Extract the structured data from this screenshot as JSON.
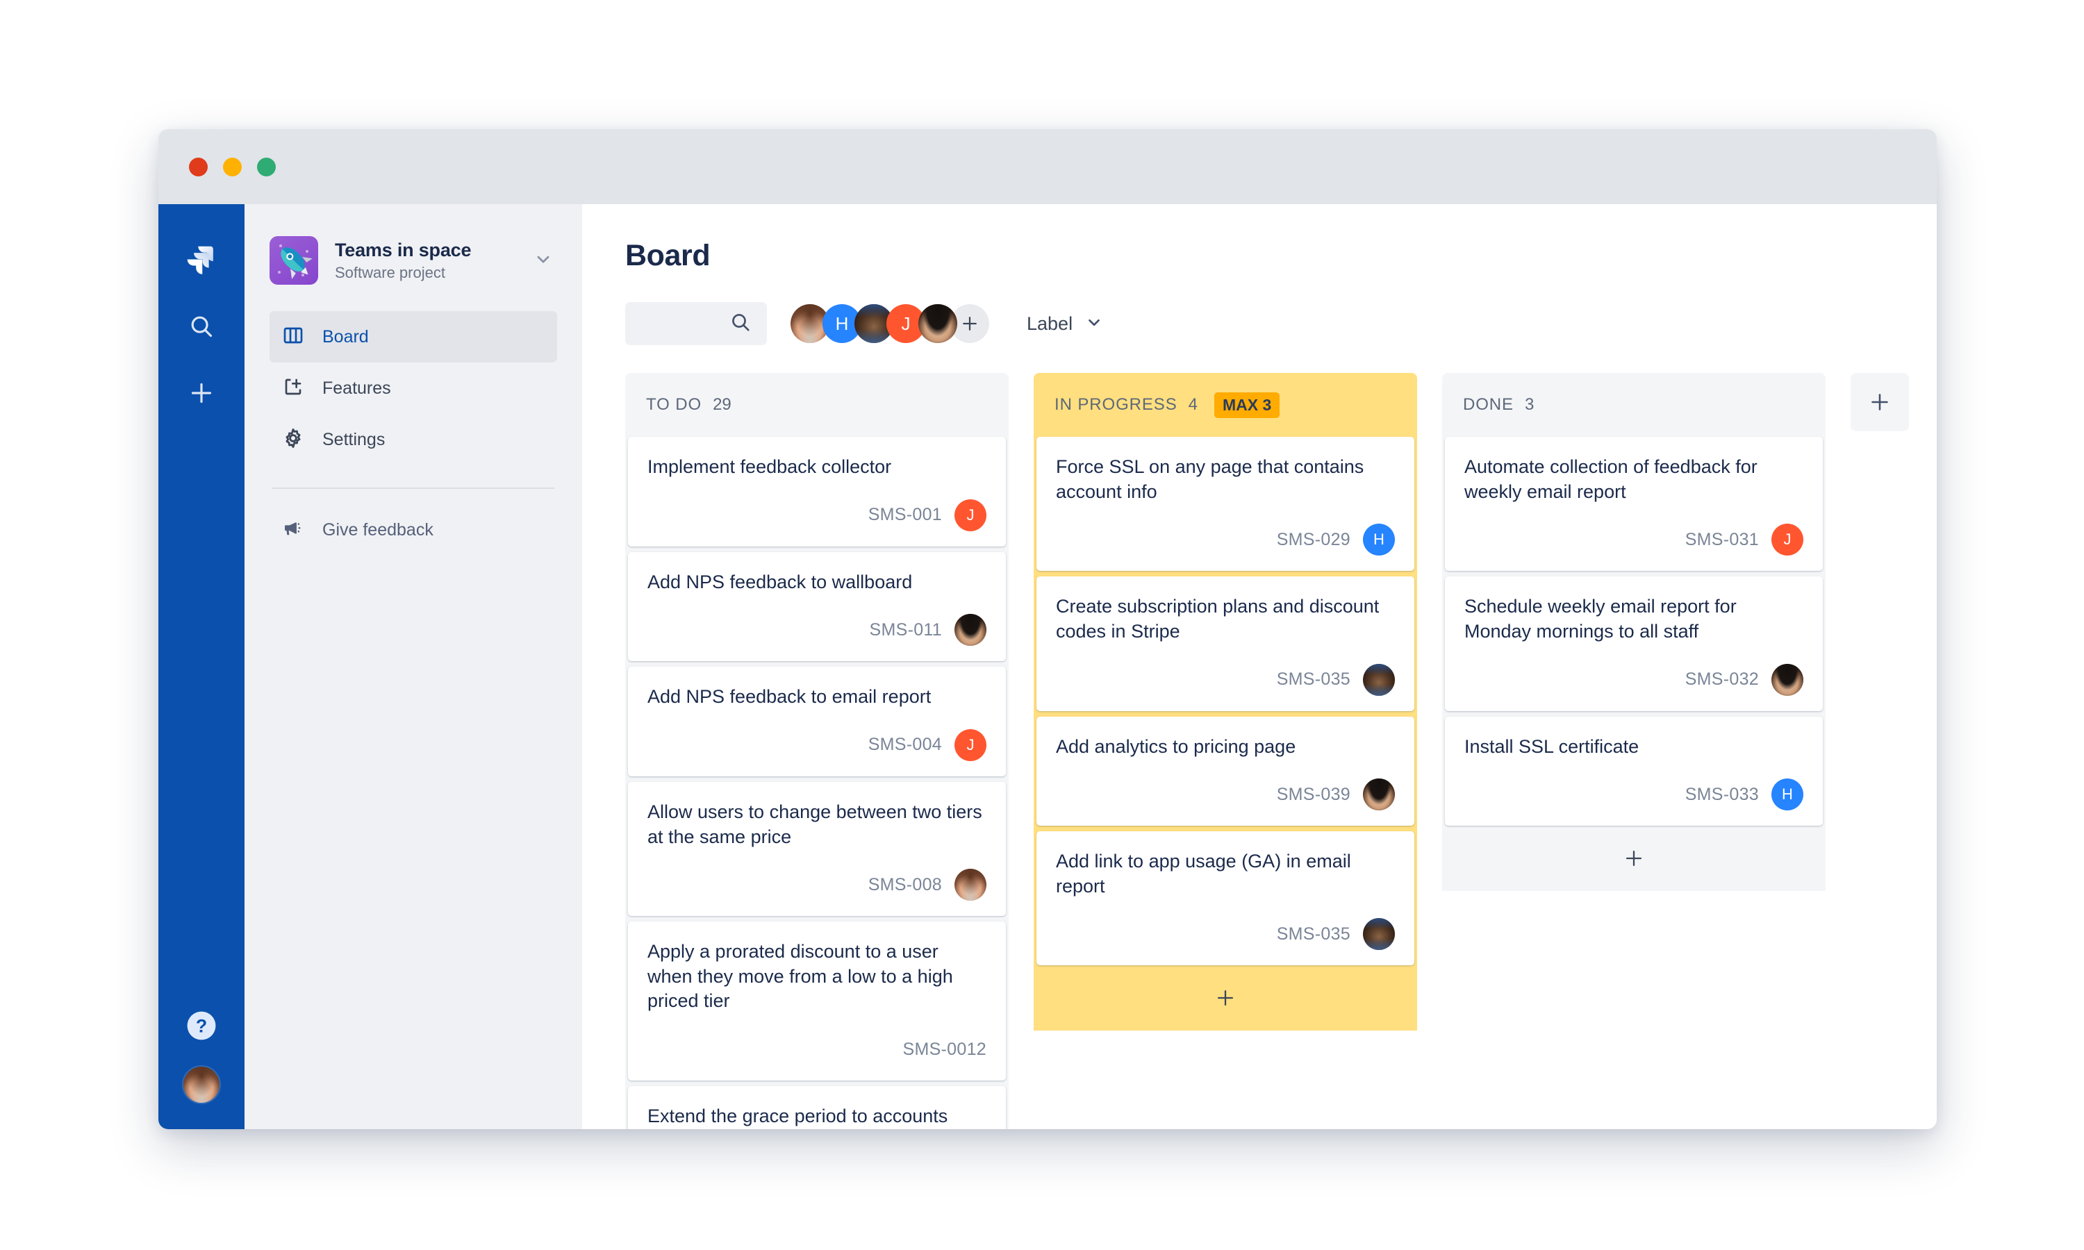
{
  "window": {
    "traffic_lights": [
      "close",
      "minimize",
      "maximize"
    ],
    "colors": {
      "close": "#e03b1b",
      "minimize": "#ffb103",
      "maximize": "#2fac74"
    }
  },
  "global_rail": {
    "logo": "jira-logo",
    "items": [
      {
        "icon": "search-icon",
        "name": "search"
      },
      {
        "icon": "plus-icon",
        "name": "create"
      }
    ],
    "bottom": [
      {
        "icon": "help-icon",
        "name": "help"
      },
      {
        "icon": "avatar",
        "name": "profile"
      }
    ],
    "background": "#0b50ac"
  },
  "sidebar": {
    "project": {
      "name": "Teams in space",
      "type": "Software project",
      "avatar_icon": "rocket-icon",
      "chevron": "chevron-down-icon"
    },
    "nav_items": [
      {
        "label": "Board",
        "icon": "board-icon",
        "active": true
      },
      {
        "label": "Features",
        "icon": "add-page-icon",
        "active": false
      },
      {
        "label": "Settings",
        "icon": "gear-icon",
        "active": false
      }
    ],
    "feedback": {
      "label": "Give feedback",
      "icon": "megaphone-icon"
    }
  },
  "board": {
    "title": "Board",
    "search": {
      "placeholder": "",
      "value": "",
      "icon": "search-icon"
    },
    "members": [
      {
        "initial": "",
        "type": "photo",
        "photo": "ph-a",
        "name": "member-1"
      },
      {
        "initial": "H",
        "type": "initial",
        "color": "#2684ff",
        "name": "member-2"
      },
      {
        "initial": "",
        "type": "photo",
        "photo": "ph-b",
        "name": "member-3"
      },
      {
        "initial": "J",
        "type": "initial",
        "color": "#ff5630",
        "name": "member-4"
      },
      {
        "initial": "",
        "type": "photo",
        "photo": "ph-c",
        "name": "member-5"
      }
    ],
    "add_member_icon": "plus-icon",
    "label_filter": {
      "text": "Label",
      "icon": "chevron-down-icon"
    },
    "add_column_icon": "plus-icon",
    "columns": [
      {
        "name": "TO DO",
        "count": "29",
        "max": null,
        "wip_exceeded": false,
        "background": "#f4f5f7",
        "show_add": false,
        "cards": [
          {
            "title": "Implement feedback collector",
            "key": "SMS-001",
            "assignee": {
              "type": "initial",
              "initial": "J",
              "color": "#ff5630"
            }
          },
          {
            "title": "Add NPS feedback to wallboard",
            "key": "SMS-011",
            "assignee": {
              "type": "photo",
              "photo": "ph-c"
            }
          },
          {
            "title": "Add NPS feedback to email report",
            "key": "SMS-004",
            "assignee": {
              "type": "initial",
              "initial": "J",
              "color": "#ff5630"
            }
          },
          {
            "title": "Allow users to change between two tiers at the same price",
            "key": "SMS-008",
            "assignee": {
              "type": "photo",
              "photo": "ph-a"
            }
          },
          {
            "title": "Apply a prorated discount to a user when they move from a low to a high priced tier",
            "key": "SMS-0012",
            "assignee": null
          },
          {
            "title": "Extend the grace period to accounts",
            "key": "",
            "assignee": null
          }
        ]
      },
      {
        "name": "IN PROGRESS",
        "count": "4",
        "max": "MAX 3",
        "wip_exceeded": true,
        "background": "#ffdf7f",
        "show_add": true,
        "cards": [
          {
            "title": "Force SSL on any page that contains account info",
            "key": "SMS-029",
            "assignee": {
              "type": "initial",
              "initial": "H",
              "color": "#2684ff"
            }
          },
          {
            "title": "Create subscription plans and discount codes in Stripe",
            "key": "SMS-035",
            "assignee": {
              "type": "photo",
              "photo": "ph-b"
            }
          },
          {
            "title": "Add analytics to pricing page",
            "key": "SMS-039",
            "assignee": {
              "type": "photo",
              "photo": "ph-c"
            }
          },
          {
            "title": "Add link to app usage (GA) in email report",
            "key": "SMS-035",
            "assignee": {
              "type": "photo",
              "photo": "ph-b"
            }
          }
        ]
      },
      {
        "name": "DONE",
        "count": "3",
        "max": null,
        "wip_exceeded": false,
        "background": "#f4f5f7",
        "show_add": true,
        "cards": [
          {
            "title": "Automate collection of feedback for weekly email report",
            "key": "SMS-031",
            "assignee": {
              "type": "initial",
              "initial": "J",
              "color": "#ff5630"
            }
          },
          {
            "title": "Schedule weekly email report for Monday mornings to all staff",
            "key": "SMS-032",
            "assignee": {
              "type": "photo",
              "photo": "ph-c"
            }
          },
          {
            "title": "Install SSL certificate",
            "key": "SMS-033",
            "assignee": {
              "type": "initial",
              "initial": "H",
              "color": "#2684ff"
            }
          }
        ]
      }
    ]
  }
}
